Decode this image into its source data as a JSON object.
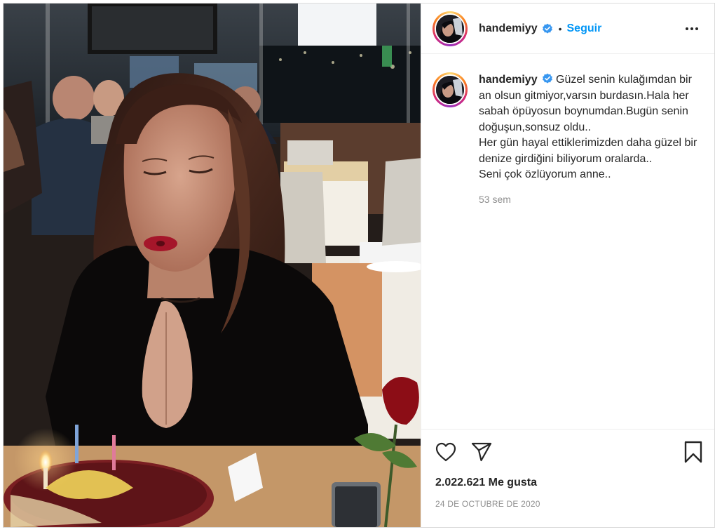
{
  "post": {
    "photo_alt": "Photo of a woman blowing out birthday candles",
    "author": {
      "username": "handemiyy",
      "verified": true
    },
    "header": {
      "separator": "•",
      "follow_label": "Seguir"
    },
    "caption": {
      "username": "handemiyy",
      "text": "Güzel senin kulağımdan bir an olsun gitmiyor,varsın burdasın.Hala her sabah öpüyosun boynumdan.Bugün senin doğuşun,sonsuz oldu..\nHer gün hayal ettiklerimizden daha güzel bir denize girdiğini biliyorum oralarda..\nSeni çok özlüyorum anne..",
      "time_ago": "53 sem"
    },
    "likes": "2.022.621 Me gusta",
    "date": "24 DE OCTUBRE DE 2020"
  },
  "icons": {
    "verified": "verified-badge-icon",
    "more": "more-options-icon",
    "like": "heart-icon",
    "share": "share-icon",
    "save": "bookmark-icon"
  },
  "colors": {
    "accent": "#0095f6",
    "text": "#262626",
    "muted": "#8e8e8e",
    "border": "#efefef"
  }
}
